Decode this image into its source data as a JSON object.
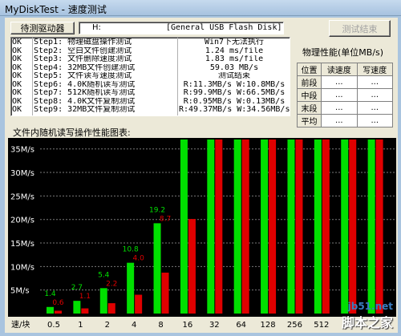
{
  "window": {
    "title": "MyDiskTest - 速度测试"
  },
  "toolbar": {
    "drive_button": "待测驱动器",
    "drive_letter": "H:",
    "drive_name": "[General USB Flash Disk]",
    "end_button": "测试结束"
  },
  "steps": [
    {
      "status": "OK",
      "name": "Step1: 物理磁盘操作测试",
      "result": "Win7下无法执行"
    },
    {
      "status": "OK",
      "name": "Step2: 空白文件创建测试",
      "result": "1.24 ms/file"
    },
    {
      "status": "OK",
      "name": "Step3: 文件删除速度测试",
      "result": "1.83 ms/file"
    },
    {
      "status": "OK",
      "name": "Step4: 32MB文件创建测试",
      "result": "59.03 MB/s"
    },
    {
      "status": "OK",
      "name": "Step5: 文件读写速度测试",
      "result": "测试结束"
    },
    {
      "status": "OK",
      "name": "Step6: 4.0K随机读写测试",
      "result": "R:11.3MB/s W:10.8MB/s"
    },
    {
      "status": "OK",
      "name": "Step7: 512K随机读写测试",
      "result": "R:99.9MB/s W:66.5MB/s"
    },
    {
      "status": "OK",
      "name": "Step8: 4.0K文件复制测试",
      "result": "R:0.95MB/s W:0.13MB/s"
    },
    {
      "status": "OK",
      "name": "Step9: 32MB文件复制测试",
      "result": "R:49.37MB/s W:34.56MB/s"
    }
  ],
  "perf_table": {
    "title": "物理性能(单位MB/s)",
    "headers": [
      "位置",
      "读速度",
      "写速度"
    ],
    "rows": [
      {
        "pos": "前段",
        "read": "...",
        "write": "..."
      },
      {
        "pos": "中段",
        "read": "...",
        "write": "..."
      },
      {
        "pos": "末段",
        "read": "...",
        "write": "..."
      },
      {
        "pos": "平均",
        "read": "...",
        "write": "..."
      }
    ]
  },
  "chart_label": "文件内随机读写操作性能图表:",
  "colors": {
    "read": "#00e000",
    "write": "#e00000",
    "bg": "#000000"
  },
  "chart_data": {
    "type": "bar",
    "ylim": [
      0,
      37
    ],
    "yticks": [
      0,
      5,
      10,
      15,
      20,
      25,
      30,
      35
    ],
    "ytick_labels": [
      "",
      "5M/s",
      "10M/s",
      "15M/s",
      "20M/s",
      "25M/s",
      "30M/s",
      "35M/s"
    ],
    "xlabel": "速/块",
    "categories": [
      "0.5",
      "1",
      "2",
      "4",
      "8",
      "16",
      "32",
      "64",
      "128",
      "256",
      "512"
    ],
    "series": [
      {
        "values": [
          1.4,
          2.7,
          5.4,
          10.8,
          19.2,
          37,
          37,
          37,
          37,
          37,
          37,
          37,
          37
        ]
      },
      {
        "values": [
          0.6,
          1.1,
          2.2,
          4.0,
          8.7,
          20.1,
          37,
          37,
          37,
          37,
          37,
          37,
          37
        ]
      }
    ],
    "read_labels": [
      "1.4",
      "2.7",
      "5.4",
      "10.8",
      "19.2"
    ],
    "write_labels": [
      "0.6",
      "1.1",
      "2.2",
      "4.0",
      "8.7"
    ]
  },
  "watermark": {
    "line1": "jb51.net",
    "line2": "脚本之家"
  }
}
